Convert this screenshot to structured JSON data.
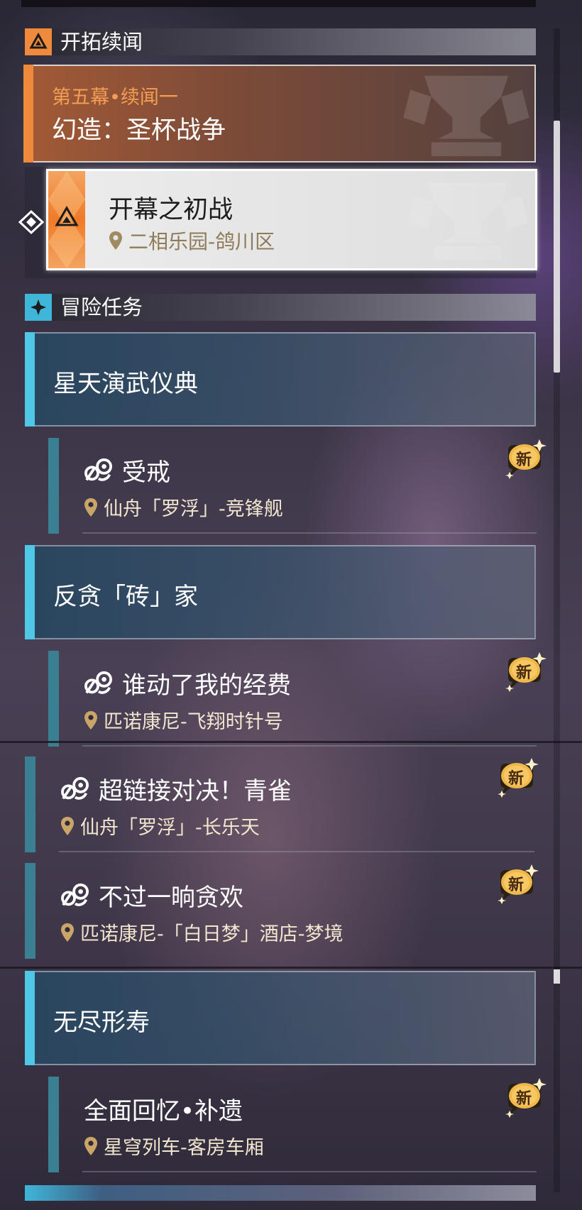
{
  "trailblaze_section": {
    "title": "开拓续闻",
    "icon": "trailblaze-triangle-icon",
    "card": {
      "subtitle": "第五幕•续闻一",
      "title": "幻造：圣杯战争"
    },
    "current_quest": {
      "title": "开幕之初战",
      "location": "二相乐园-鸽川区"
    }
  },
  "adventure_section": {
    "title": "冒险任务",
    "icon": "adventure-star-icon",
    "groups": [
      {
        "title": "星天演武仪典"
      },
      {
        "title": "反贪「砖」家"
      },
      {
        "title": "无尽形寿"
      }
    ],
    "quests": [
      {
        "title": "受戒",
        "location": "仙舟「罗浮」-竞锋舰",
        "badge": "新"
      },
      {
        "title": "谁动了我的经费",
        "location": "匹诺康尼-飞翔时针号",
        "badge": "新"
      },
      {
        "title": "超链接对决！青雀",
        "location": "仙舟「罗浮」-长乐天",
        "badge": "新"
      },
      {
        "title": "不过一晌贪欢",
        "location": "匹诺康尼-「白日梦」酒店-梦境",
        "badge": "新"
      },
      {
        "title": "全面回忆•补遗",
        "location": "星穹列车-客房车厢",
        "badge": "新"
      }
    ]
  },
  "colors": {
    "trailblaze_accent": "#ef8a3c",
    "adventure_accent": "#4fc8e8",
    "location_pin": "#c9a56a",
    "new_badge": "#f0b84a"
  }
}
